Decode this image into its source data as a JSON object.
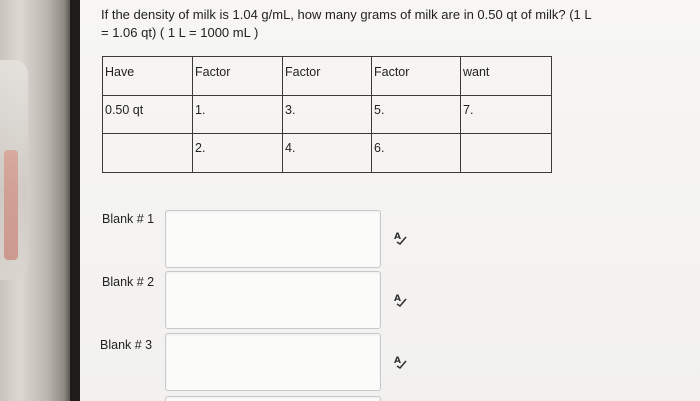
{
  "question": "If the density of milk is 1.04 g/mL, how many grams of milk are in 0.50 qt of milk? (1 L = 1.06 qt) ( 1 L = 1000 mL )",
  "table": {
    "headers": [
      "Have",
      "Factor",
      "Factor",
      "Factor",
      "want"
    ],
    "rows": [
      [
        "0.50 qt",
        "1.",
        "3.",
        "5.",
        "7."
      ],
      [
        "",
        "2.",
        "4.",
        "6.",
        ""
      ]
    ]
  },
  "blanks": [
    {
      "label": "Blank # 1",
      "value": ""
    },
    {
      "label": "Blank # 2",
      "value": ""
    },
    {
      "label": "Blank # 3",
      "value": ""
    }
  ],
  "icons": {
    "spellcheck": "spellcheck-icon"
  }
}
